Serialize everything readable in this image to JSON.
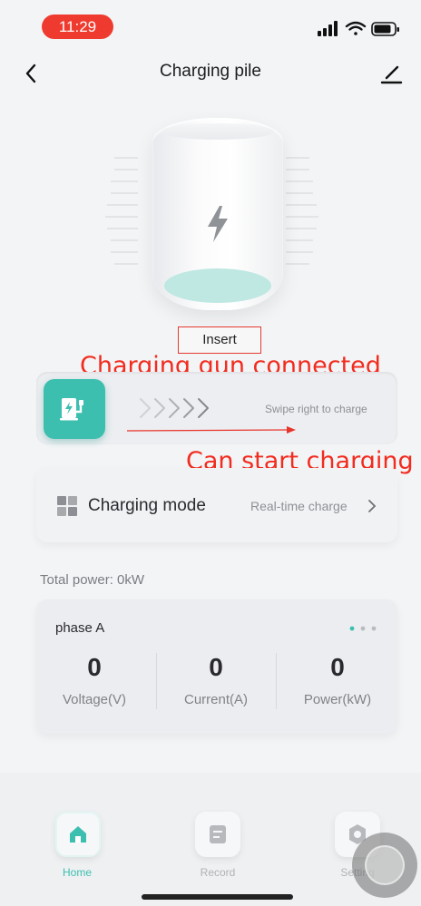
{
  "status_bar": {
    "time": "11:29"
  },
  "header": {
    "title": "Charging pile"
  },
  "pile": {
    "state_label": "Insert"
  },
  "annotations": {
    "connected_note": "Charging gun connected",
    "start_note": "Can start charging"
  },
  "swipe": {
    "hint": "Swipe right to charge"
  },
  "charging_mode": {
    "label": "Charging mode",
    "value": "Real-time charge"
  },
  "total_power": "Total power:  0kW",
  "phase": {
    "title": "phase A",
    "metrics": [
      {
        "value": "0",
        "label": "Voltage(V)"
      },
      {
        "value": "0",
        "label": "Current(A)"
      },
      {
        "value": "0",
        "label": "Power(kW)"
      }
    ]
  },
  "nav": {
    "items": [
      {
        "label": "Home",
        "icon": "home-icon"
      },
      {
        "label": "Record",
        "icon": "record-icon"
      },
      {
        "label": "Setting",
        "icon": "gear-icon"
      }
    ]
  },
  "colors": {
    "accent": "#3dbfb0",
    "annotation_red": "#f22c1f",
    "time_pill": "#ef3b2f"
  }
}
